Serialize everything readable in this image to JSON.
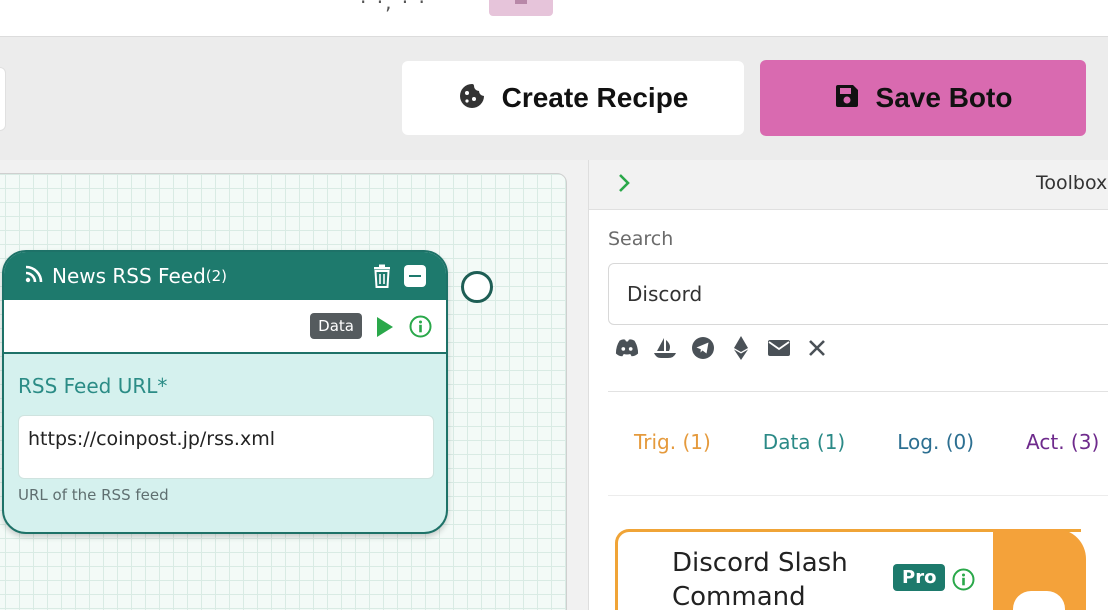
{
  "topbar": {
    "fragment_text": "· ·, · ·"
  },
  "toolbar": {
    "create_recipe_label": "Create Recipe",
    "save_label": "Save Boto",
    "save_color": "#d96ab0"
  },
  "node": {
    "title": "News RSS Feed",
    "count": "(2)",
    "type_badge": "Data",
    "field_label": "RSS Feed URL*",
    "field_value": "https://coinpost.jp/rss.xml",
    "field_help": "URL of the RSS feed",
    "accent_color": "#1e7a6d",
    "icons": [
      "rss-icon",
      "trash-icon",
      "minimize-icon",
      "play-icon",
      "info-icon"
    ]
  },
  "toolbox": {
    "title": "Toolbox",
    "search_label": "Search",
    "search_value": "Discord",
    "filter_icons": [
      "discord-icon",
      "opensea-icon",
      "telegram-icon",
      "ethereum-icon",
      "email-icon",
      "x-icon"
    ],
    "tabs": [
      {
        "label": "Trig. (1)",
        "color": "#e59a3c"
      },
      {
        "label": "Data (1)",
        "color": "#2b8a87"
      },
      {
        "label": "Log. (0)",
        "color": "#2c6f91"
      },
      {
        "label": "Act. (3)",
        "color": "#6e2a8c"
      }
    ],
    "card": {
      "title": "Discord Slash Command",
      "badge": "Pro",
      "accent_color": "#f4a23a"
    }
  }
}
